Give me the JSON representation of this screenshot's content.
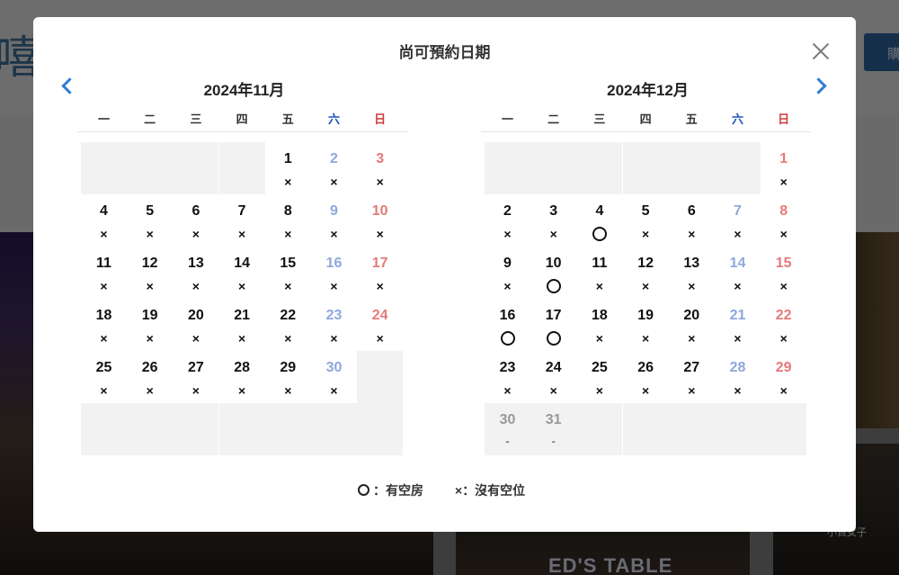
{
  "background": {
    "logo_text": "嘻",
    "buy_button_label": "購",
    "banner_text": "ED'S TABLE",
    "watermark_text": "小資女子"
  },
  "modal": {
    "title": "尚可預約日期",
    "close_icon": "close-icon",
    "prev_icon": "chevron-left-icon",
    "next_icon": "chevron-right-icon",
    "weekday_labels": [
      "一",
      "二",
      "三",
      "四",
      "五",
      "六",
      "日"
    ],
    "accent_color": "#2f7fd2",
    "saturday_color": "#1f4fbf",
    "sunday_color": "#d43a3a",
    "months": [
      {
        "title": "2024年11月",
        "first_weekday_index": 4,
        "days_in_month": 30,
        "total_rows": 6,
        "availability": {
          "1": "×",
          "2": "×",
          "3": "×",
          "4": "×",
          "5": "×",
          "6": "×",
          "7": "×",
          "8": "×",
          "9": "×",
          "10": "×",
          "11": "×",
          "12": "×",
          "13": "×",
          "14": "×",
          "15": "×",
          "16": "×",
          "17": "×",
          "18": "×",
          "19": "×",
          "20": "×",
          "21": "×",
          "22": "×",
          "23": "×",
          "24": "×",
          "25": "×",
          "26": "×",
          "27": "×",
          "28": "×",
          "29": "×",
          "30": "×"
        }
      },
      {
        "title": "2024年12月",
        "first_weekday_index": 6,
        "days_in_month": 31,
        "total_rows": 6,
        "availability": {
          "1": "×",
          "2": "×",
          "3": "×",
          "4": "○",
          "5": "×",
          "6": "×",
          "7": "×",
          "8": "×",
          "9": "×",
          "10": "○",
          "11": "×",
          "12": "×",
          "13": "×",
          "14": "×",
          "15": "×",
          "16": "○",
          "17": "○",
          "18": "×",
          "19": "×",
          "20": "×",
          "21": "×",
          "22": "×",
          "23": "×",
          "24": "×",
          "25": "×",
          "26": "×",
          "27": "×",
          "28": "×",
          "29": "×",
          "30": "-",
          "31": "-"
        },
        "past_days": [
          30,
          31
        ]
      }
    ],
    "legend": {
      "available_label": "：有空房",
      "full_symbol": "×",
      "full_label": "：沒有空位"
    }
  }
}
